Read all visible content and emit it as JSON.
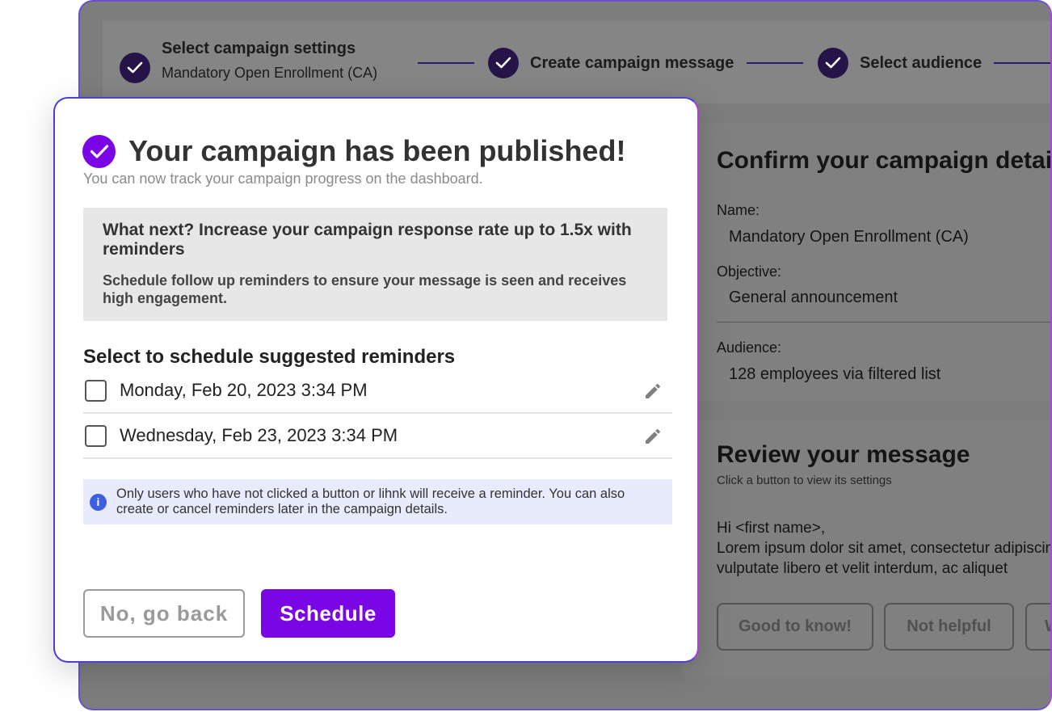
{
  "stepper": {
    "step1_title": "Select campaign settings",
    "step1_sub": "Mandatory Open Enrollment (CA)",
    "step2_title": "Create campaign message",
    "step3_title": "Select audience"
  },
  "details": {
    "heading": "Confirm your campaign details",
    "name_label": "Name:",
    "name_value": "Mandatory Open Enrollment (CA)",
    "objective_label": "Objective:",
    "objective_value": "General announcement",
    "audience_label": "Audience:",
    "audience_value": "128 employees via filtered list"
  },
  "review": {
    "heading": "Review your message",
    "hint": "Click a button to view its settings",
    "greeting": "Hi <first name>,",
    "body_line1": "Lorem ipsum dolor sit amet, consectetur adipiscing elit.",
    "body_line2": "vulputate libero et velit interdum, ac aliquet",
    "buttons": [
      "Good to know!",
      "Not helpful",
      "W"
    ]
  },
  "modal": {
    "title": "Your campaign has been published!",
    "subtitle": "You can now track your campaign progress on the dashboard.",
    "promo_title": "What next? Increase your campaign response rate up to 1.5x with reminders",
    "promo_body": "Schedule follow up reminders to ensure your message is seen and receives high engagement.",
    "section_title": "Select to schedule suggested reminders",
    "reminders": [
      {
        "label": "Monday, Feb 20, 2023 3:34 PM",
        "checked": false
      },
      {
        "label": "Wednesday, Feb 23, 2023 3:34 PM",
        "checked": false
      }
    ],
    "info": "Only users who have not clicked a button or lihnk will receive a reminder. You can also create or cancel reminders later in the campaign details.",
    "back_label": "No, go back",
    "schedule_label": "Schedule"
  },
  "colors": {
    "accent": "#7a06e6",
    "step_check": "#261448",
    "info_bg": "#e8ebfb"
  }
}
